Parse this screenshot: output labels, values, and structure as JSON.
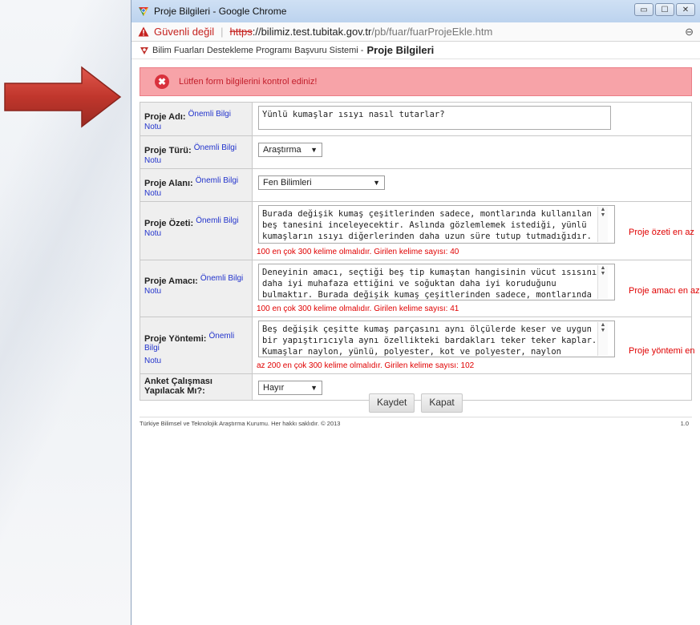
{
  "window": {
    "title": "Proje Bilgileri - Google Chrome",
    "buttons": [
      "▭",
      "☐",
      "✕"
    ]
  },
  "address": {
    "security": "Güvenli değil",
    "scheme": "https",
    "host": "://bilimiz.test.tubitak.gov.tr",
    "path": "/pb/fuar/fuarProjeEkle.htm"
  },
  "app": {
    "system": "Bilim Fuarları Destekleme Programı Başvuru Sistemi -",
    "page": "Proje Bilgileri"
  },
  "error": {
    "icon": "x-circle-icon",
    "message": "Lütfen form bilgilerini kontrol ediniz!"
  },
  "help_link": {
    "part1": "Önemli Bilgi",
    "part2": "Notu"
  },
  "form": {
    "proje_adi": {
      "label": "Proje Adı:",
      "value": "Yünlü kumaşlar ısıyı nasıl tutarlar?"
    },
    "proje_turu": {
      "label": "Proje Türü:",
      "value": "Araştırma"
    },
    "proje_alani": {
      "label": "Proje Alanı:",
      "value": "Fen Bilimleri"
    },
    "proje_ozeti": {
      "label": "Proje Özeti:",
      "value": "Burada değişik kumaş çeşitlerinden sadece, montlarında kullanılan beş tanesini inceleyecektir. Aslında gözlemlemek istediği, yünlü kumaşların ısıyı diğerlerinden daha uzun süre tutup tutmadığıdır.",
      "counter": "100 en çok 300 kelime olmalıdır. Girilen kelime sayısı: 40",
      "side": "Proje özeti en az"
    },
    "proje_amaci": {
      "label": "Proje Amacı:",
      "value": "Deneyinin amacı, seçtiği beş tip kumaştan hangisinin vücut ısısını daha iyi muhafaza ettiğini ve soğuktan daha iyi koruduğunu bulmaktır. Burada değişik kumaş çeşitlerinden sadece, montlarında",
      "counter": "100 en çok 300 kelime olmalıdır. Girilen kelime sayısı: 41",
      "side": "Proje amacı en az"
    },
    "proje_yontemi": {
      "label": "Proje Yöntemi:",
      "value": "Beş değişik çeşitte kumaş parçasını aynı ölçülerde keser ve uygun bir yapıştırıcıyla aynı özellikteki bardakları teker teker kaplar. Kumaşlar naylon, yünlü, polyester, kot ve polyester, naylon",
      "counter": "az 200 en çok 300 kelime olmalıdır. Girilen kelime sayısı: 102",
      "side": "Proje yöntemi en"
    },
    "anket": {
      "label": "Anket Çalışması Yapılacak Mı?:",
      "value": "Hayır"
    }
  },
  "buttons": {
    "save": "Kaydet",
    "close": "Kapat"
  },
  "footer": {
    "text": "Türkiye Bilimsel ve Teknolojik Araştırma Kurumu. Her hakkı saklıdır. © 2013",
    "version": "1.0"
  }
}
